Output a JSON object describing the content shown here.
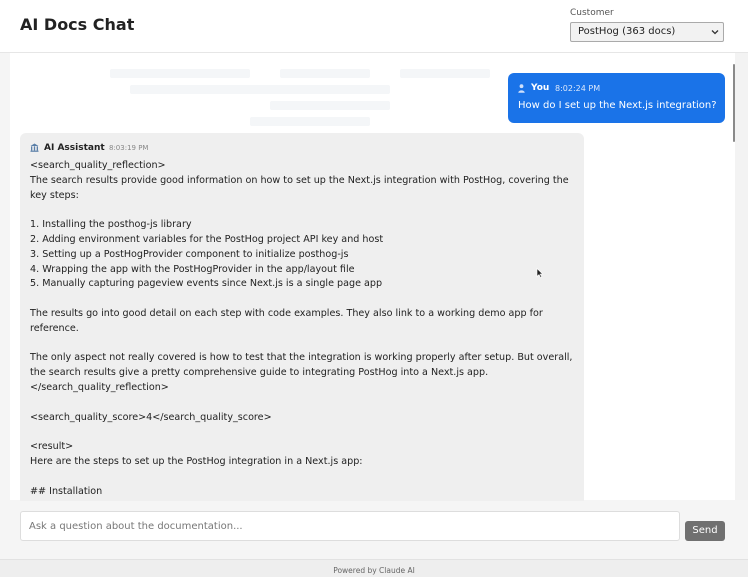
{
  "header": {
    "title": "AI Docs Chat",
    "customer_label": "Customer",
    "customer_selected": "PostHog (363 docs)"
  },
  "messages": {
    "user": {
      "name": "You",
      "time": "8:02:24 PM",
      "text": "How do I set up the Next.js integration?"
    },
    "assistant": {
      "name": "AI Assistant",
      "time": "8:03:19 PM",
      "text": "<search_quality_reflection>\nThe search results provide good information on how to set up the Next.js integration with PostHog, covering the key steps:\n\n1. Installing the posthog-js library\n2. Adding environment variables for the PostHog project API key and host\n3. Setting up a PostHogProvider component to initialize posthog-js\n4. Wrapping the app with the PostHogProvider in the app/layout file\n5. Manually capturing pageview events since Next.js is a single page app\n\nThe results go into good detail on each step with code examples. They also link to a working demo app for reference.\n\nThe only aspect not really covered is how to test that the integration is working properly after setup. But overall, the search results give a pretty comprehensive guide to integrating PostHog into a Next.js app.\n</search_quality_reflection>\n\n<search_quality_score>4</search_quality_score>\n\n<result>\nHere are the steps to set up the PostHog integration in a Next.js app:\n\n## Installation"
    }
  },
  "input": {
    "placeholder": "Ask a question about the documentation...",
    "value": "",
    "send_label": "Send"
  },
  "footer": {
    "text": "Powered by Claude AI"
  },
  "colors": {
    "accent": "#1a73e8",
    "send_button": "#707070",
    "assistant_bubble": "#efefef"
  },
  "icons": {
    "user": "person-icon",
    "assistant": "building-icon",
    "select": "chevron-down-icon"
  }
}
